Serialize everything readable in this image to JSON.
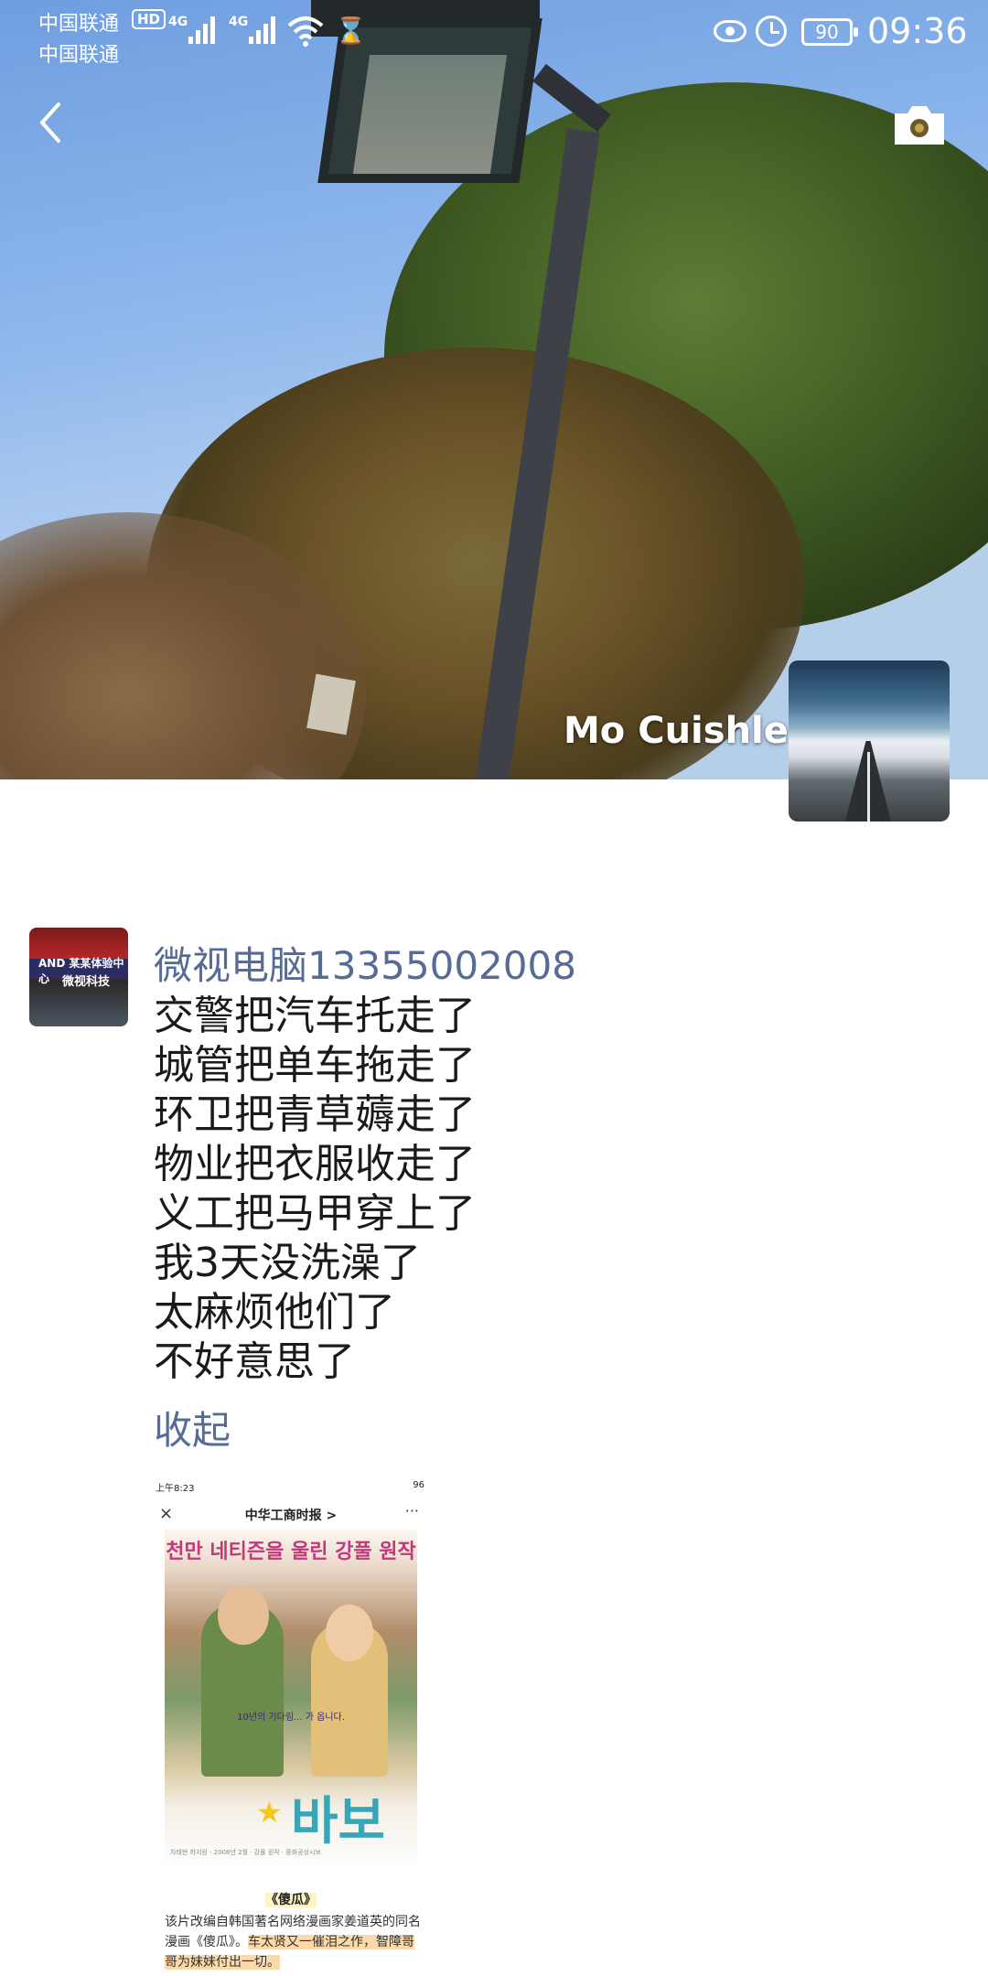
{
  "status_bar": {
    "carrier_1": "中国联通",
    "hd_label": "HD",
    "carrier_2": "中国联通",
    "network_1": "4G",
    "network_2": "4G",
    "battery": "90",
    "time": "09:36"
  },
  "cover": {
    "profile_name": "Mo Cuishle"
  },
  "post": {
    "user": "微视电脑13355002008",
    "avatar_text_1": "AND 某某体验中心",
    "avatar_text_2": "微视科技",
    "lines": [
      "交警把汽车托走了",
      "城管把单车拖走了",
      "环卫把青草薅走了",
      "物业把衣服收走了",
      "义工把马甲穿上了",
      "我3天没洗澡了",
      "太麻烦他们了",
      "不好意思了"
    ],
    "collapse_label": "收起",
    "attachment": {
      "status_time": "上午8:23",
      "status_right": "96",
      "close_icon_glyph": "×",
      "title": "中华工商时报 >",
      "more_glyph": "···",
      "poster_headline": "천만 네티즌을 울린 강풀 원작",
      "poster_tagline": "10년의 기다림... 가 옵니다.",
      "poster_logo": "바보",
      "poster_credits": "차태현 하지원 · 2008년 2월 · 강풀 원작 · 중화공상시보",
      "caption_title": "《傻瓜》",
      "caption_plain": "该片改编自韩国著名网络漫画家姜道英的同名漫画《傻瓜》。",
      "caption_highlight": "车太贤又一催泪之作，智障哥哥为妹妹付出一切。"
    }
  },
  "colors": {
    "link": "#576b95",
    "text": "#1a1a1a"
  }
}
